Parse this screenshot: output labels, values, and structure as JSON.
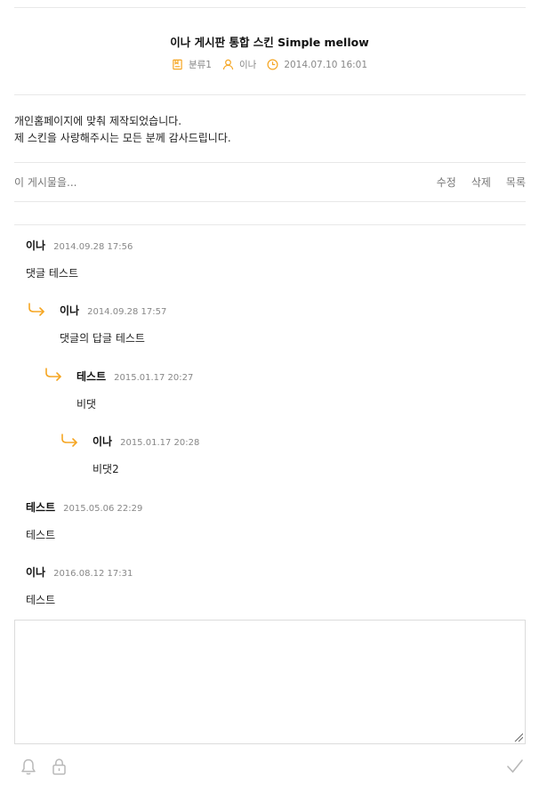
{
  "post": {
    "title": "이나 게시판 통합 스킨 Simple mellow",
    "category": "분류1",
    "author": "이나",
    "datetime": "2014.07.10 16:01",
    "content_lines": [
      "개인홈페이지에 맞춰 제작되었습니다.",
      "제 스킨을 사랑해주시는 모든 분께 감사드립니다."
    ]
  },
  "toolbar": {
    "view_text": "이 게시물을...",
    "edit_label": "수정",
    "delete_label": "삭제",
    "list_label": "목록"
  },
  "comments": [
    {
      "depth": 0,
      "author": "이나",
      "date": "2014.09.28 17:56",
      "body": "댓글 테스트"
    },
    {
      "depth": 1,
      "author": "이나",
      "date": "2014.09.28 17:57",
      "body": "댓글의 답글 테스트"
    },
    {
      "depth": 2,
      "author": "테스트",
      "date": "2015.01.17 20:27",
      "body": "비댓"
    },
    {
      "depth": 3,
      "author": "이나",
      "date": "2015.01.17 20:28",
      "body": "비댓2"
    },
    {
      "depth": 0,
      "author": "테스트",
      "date": "2015.05.06 22:29",
      "body": "테스트"
    },
    {
      "depth": 0,
      "author": "이나",
      "date": "2016.08.12 17:31",
      "body": "테스트"
    }
  ],
  "icons": {
    "category": "bookmark-icon",
    "author": "user-icon",
    "time": "clock-icon",
    "reply": "reply-arrow-icon",
    "notify": "bell-icon",
    "secret": "lock-icon",
    "submit": "check-icon"
  },
  "colors": {
    "accent": "#f5a623",
    "muted_icon": "#b8b8b8",
    "text": "#222222",
    "meta_text": "#888888"
  }
}
